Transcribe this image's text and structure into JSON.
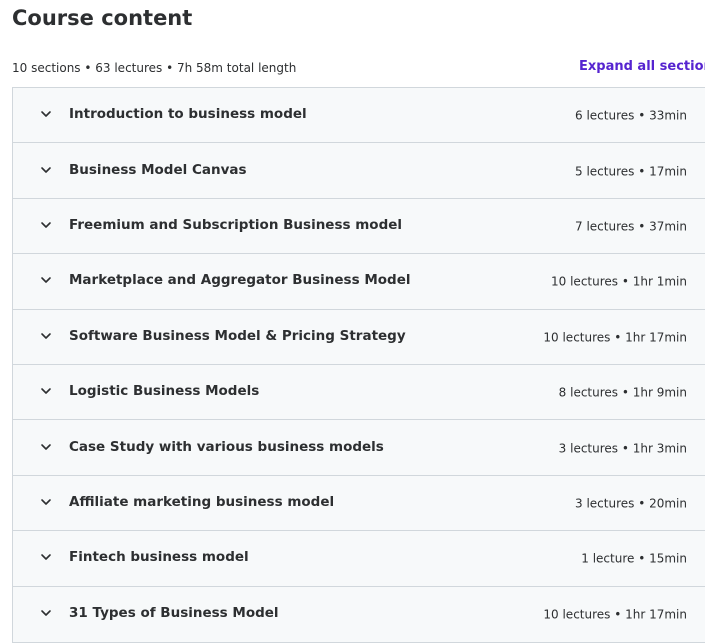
{
  "header": {
    "title": "Course content",
    "summary": "10 sections • 63 lectures • 7h 58m total length",
    "expand_all_label": "Expand all sections"
  },
  "sections": [
    {
      "title": "Introduction to business model",
      "meta": "6 lectures • 33min",
      "icon": "chevron-down-icon"
    },
    {
      "title": "Business Model Canvas",
      "meta": "5 lectures • 17min",
      "icon": "chevron-down-icon"
    },
    {
      "title": "Freemium and Subscription Business model",
      "meta": "7 lectures • 37min",
      "icon": "chevron-down-icon"
    },
    {
      "title": "Marketplace and Aggregator Business Model",
      "meta": "10 lectures • 1hr 1min",
      "icon": "chevron-down-icon"
    },
    {
      "title": "Software Business Model & Pricing Strategy",
      "meta": "10 lectures • 1hr 17min",
      "icon": "chevron-down-icon"
    },
    {
      "title": "Logistic Business Models",
      "meta": "8 lectures • 1hr 9min",
      "icon": "chevron-down-icon"
    },
    {
      "title": "Case Study with various business models",
      "meta": "3 lectures • 1hr 3min",
      "icon": "chevron-down-icon"
    },
    {
      "title": "Affiliate marketing business model",
      "meta": "3 lectures • 20min",
      "icon": "chevron-down-icon"
    },
    {
      "title": "Fintech business model",
      "meta": "1 lecture • 15min",
      "icon": "chevron-down-icon"
    },
    {
      "title": "31 Types of Business Model",
      "meta": "10 lectures • 1hr 17min",
      "icon": "chevron-down-icon"
    }
  ],
  "colors": {
    "text": "#2d2f31",
    "link": "#5624d0",
    "section_bg": "#f7f9fa",
    "border": "#d1d7dc"
  }
}
